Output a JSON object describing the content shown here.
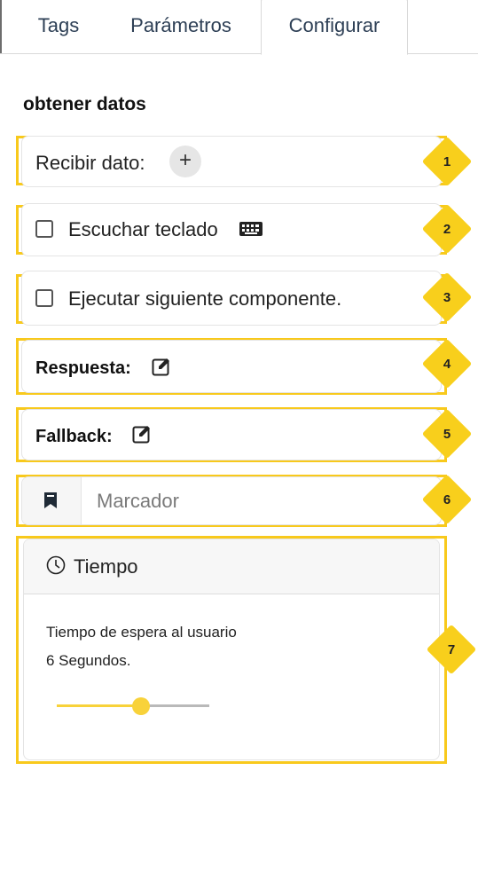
{
  "tabs": [
    {
      "label": "Tags",
      "active": false
    },
    {
      "label": "Parámetros",
      "active": false
    },
    {
      "label": "Configurar",
      "active": true
    }
  ],
  "section_title": "obtener datos",
  "rows": {
    "receive_data": {
      "label": "Recibir dato:",
      "add_icon": "+",
      "badge": "1"
    },
    "listen_keyboard": {
      "label": "Escuchar teclado",
      "icon": "keyboard-icon",
      "checked": false,
      "badge": "2"
    },
    "run_next": {
      "label": "Ejecutar siguiente componente.",
      "checked": false,
      "badge": "3"
    },
    "response": {
      "label": "Respuesta:",
      "icon": "edit-icon",
      "badge": "4"
    },
    "fallback": {
      "label": "Fallback:",
      "icon": "edit-icon",
      "badge": "5"
    },
    "marker": {
      "placeholder": "Marcador",
      "icon": "bookmark-icon",
      "badge": "6"
    }
  },
  "time_card": {
    "title": "Tiempo",
    "icon": "clock-icon",
    "description": "Tiempo de espera al usuario",
    "value_text": "6 Segundos.",
    "slider_fraction": 0.55,
    "badge": "7"
  },
  "colors": {
    "highlight": "#f8c91c",
    "badge": "#f8cf1c",
    "slider": "#f8d23a"
  }
}
